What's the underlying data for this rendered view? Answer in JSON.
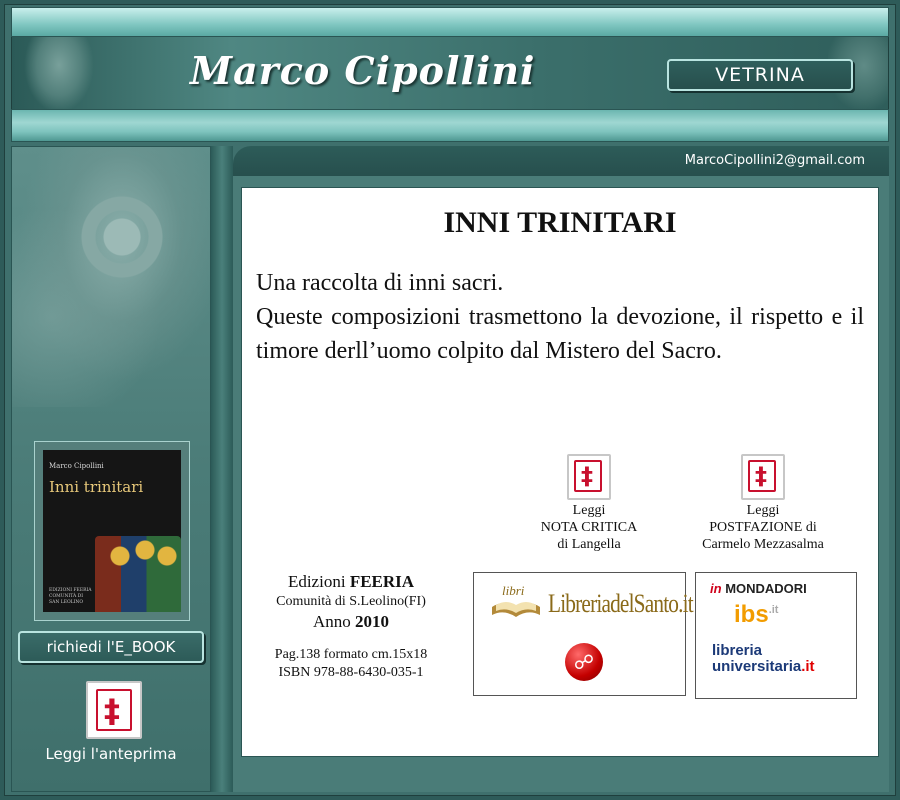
{
  "header": {
    "site_title": "Marco Cipollini",
    "vetrina_label": "VETRINA"
  },
  "contact": {
    "email": "MarcoCipollini2@gmail.com"
  },
  "sidebar": {
    "cover": {
      "author": "Marco Cipollini",
      "title": "Inni trinitari",
      "publisher": "EDIZIONI FEERIA COMUNITÀ DI SAN LEOLINO"
    },
    "ebook_button": "richiedi l'E_BOOK",
    "preview_label": "Leggi l'anteprima"
  },
  "main": {
    "title": "INNI TRINITARI",
    "intro_line1": "Una raccolta di inni sacri.",
    "intro_line2": "Queste composizioni trasmettono la devozione, il rispetto e il timore derll’uomo colpito dal Mistero del Sacro.",
    "nota_critica": {
      "line1": "Leggi",
      "line2": "NOTA CRITICA",
      "line3": "di Langella"
    },
    "postfazione": {
      "line1": "Leggi",
      "line2": "POSTFAZIONE di",
      "line3": "Carmelo Mezzasalma"
    },
    "publisher": {
      "prefix": "Edizioni ",
      "name": "FEERIA",
      "community": "Comunità di S.Leolino(FI)",
      "year_prefix": "Anno ",
      "year": "2010",
      "pages": "Pag.138  formato cm.15x18",
      "isbn": "ISBN 978-88-6430-035-1"
    },
    "stores": {
      "santo_libri": "libri",
      "santo_name": "LibreriadelSanto.it",
      "mondadori_in": "in",
      "mondadori": "MONDADORI",
      "ibs": "ibs",
      "ibs_suffix": ".it",
      "libreria_universitaria_1": "libreria",
      "libreria_universitaria_2": "universitaria",
      "libreria_universitaria_it": ".it"
    }
  },
  "colors": {
    "teal_dark": "#2e5b59",
    "teal_light": "#9fd7d2",
    "pdf_red": "#c8102e"
  }
}
